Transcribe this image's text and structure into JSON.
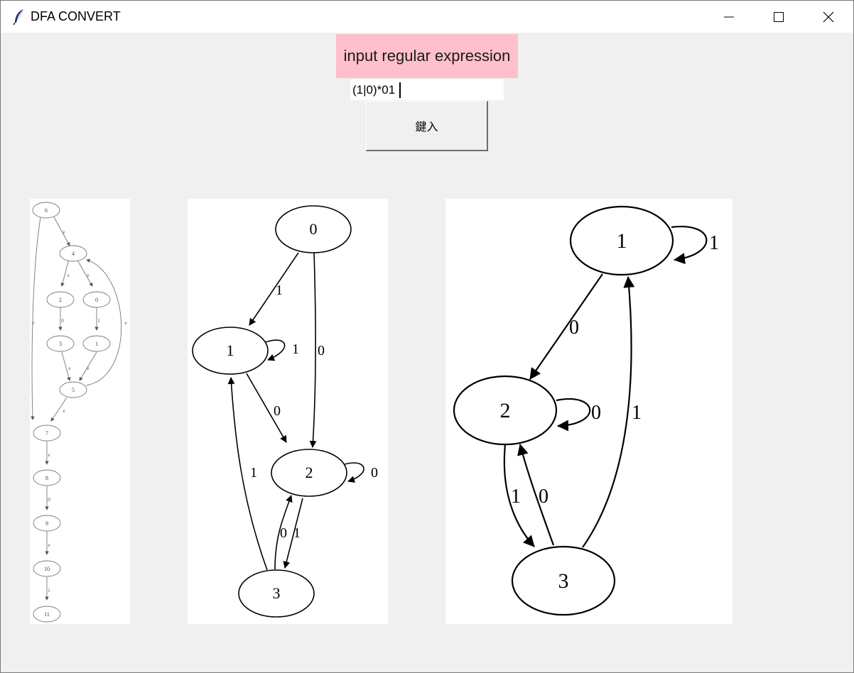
{
  "window": {
    "title": "DFA CONVERT",
    "icon": "feather-icon",
    "controls": [
      "minimize-icon",
      "maximize-icon",
      "close-icon"
    ]
  },
  "form": {
    "prompt_label": "input regular expression",
    "regex_value": "(1|0)*01",
    "submit_label": "鍵入",
    "prompt_bg": "#ffc0cb"
  },
  "nfa_graph": {
    "nodes": [
      {
        "id": "6",
        "label": "6"
      },
      {
        "id": "4",
        "label": "4"
      },
      {
        "id": "2",
        "label": "2"
      },
      {
        "id": "0",
        "label": "0"
      },
      {
        "id": "3",
        "label": "3"
      },
      {
        "id": "1",
        "label": "1"
      },
      {
        "id": "5",
        "label": "5"
      },
      {
        "id": "7",
        "label": "7"
      },
      {
        "id": "8",
        "label": "8"
      },
      {
        "id": "9",
        "label": "9"
      },
      {
        "id": "10",
        "label": "10"
      },
      {
        "id": "11",
        "label": "11"
      }
    ],
    "edges": [
      {
        "from": "6",
        "to": "4",
        "label": "e"
      },
      {
        "from": "6",
        "to": "7",
        "label": "e"
      },
      {
        "from": "4",
        "to": "2",
        "label": "e"
      },
      {
        "from": "4",
        "to": "0",
        "label": "e"
      },
      {
        "from": "2",
        "to": "3",
        "label": "0"
      },
      {
        "from": "0",
        "to": "1",
        "label": "1"
      },
      {
        "from": "3",
        "to": "5",
        "label": "e"
      },
      {
        "from": "1",
        "to": "5",
        "label": "e"
      },
      {
        "from": "5",
        "to": "4",
        "label": "e"
      },
      {
        "from": "5",
        "to": "7",
        "label": "e"
      },
      {
        "from": "7",
        "to": "8",
        "label": "e"
      },
      {
        "from": "8",
        "to": "9",
        "label": "0"
      },
      {
        "from": "9",
        "to": "10",
        "label": "e"
      },
      {
        "from": "10",
        "to": "11",
        "label": "1"
      }
    ]
  },
  "dfa_graph": {
    "nodes": [
      {
        "id": "0",
        "label": "0"
      },
      {
        "id": "1",
        "label": "1"
      },
      {
        "id": "2",
        "label": "2"
      },
      {
        "id": "3",
        "label": "3"
      }
    ],
    "edges": [
      {
        "from": "0",
        "to": "1",
        "label": "1"
      },
      {
        "from": "0",
        "to": "2",
        "label": "0"
      },
      {
        "from": "1",
        "to": "1",
        "label": "1"
      },
      {
        "from": "1",
        "to": "2",
        "label": "0"
      },
      {
        "from": "2",
        "to": "2",
        "label": "0"
      },
      {
        "from": "2",
        "to": "3",
        "label": "1"
      },
      {
        "from": "3",
        "to": "2",
        "label": "0"
      },
      {
        "from": "3",
        "to": "1",
        "label": "1"
      }
    ]
  },
  "min_dfa_graph": {
    "nodes": [
      {
        "id": "1",
        "label": "1"
      },
      {
        "id": "2",
        "label": "2"
      },
      {
        "id": "3",
        "label": "3"
      }
    ],
    "edges": [
      {
        "from": "1",
        "to": "1",
        "label": "1"
      },
      {
        "from": "1",
        "to": "2",
        "label": "0"
      },
      {
        "from": "2",
        "to": "2",
        "label": "0"
      },
      {
        "from": "2",
        "to": "3",
        "label": "1"
      },
      {
        "from": "3",
        "to": "2",
        "label": "0"
      },
      {
        "from": "3",
        "to": "1",
        "label": "1"
      }
    ]
  }
}
